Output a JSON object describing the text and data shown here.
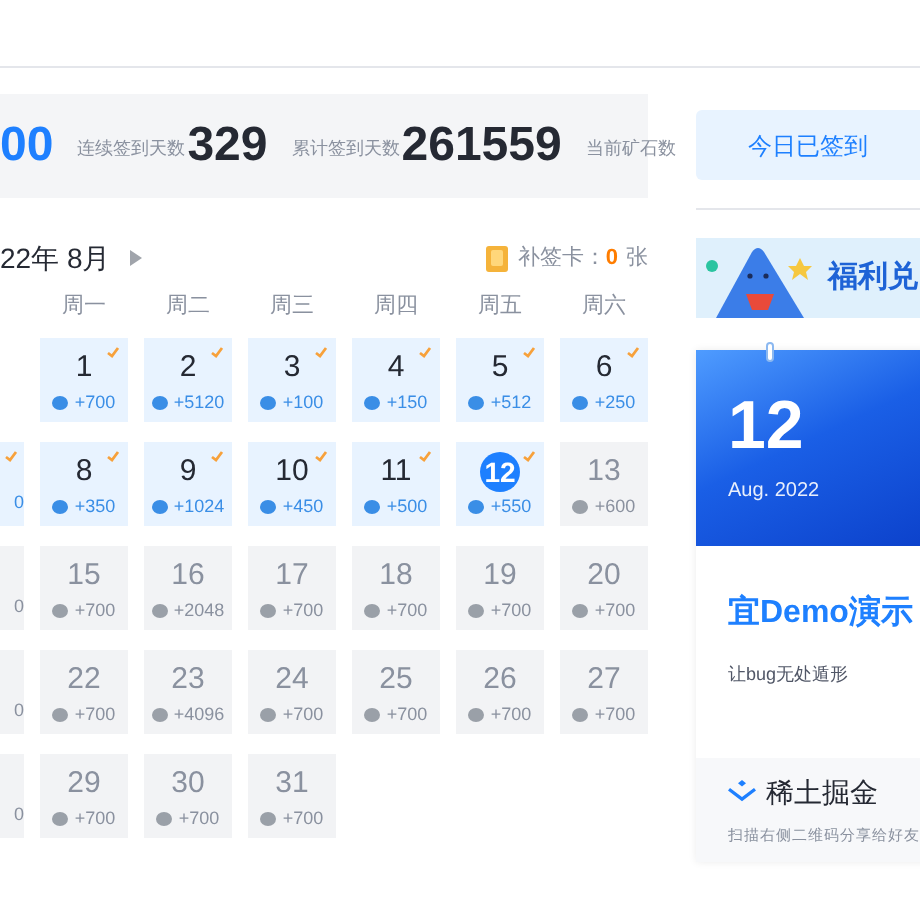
{
  "stats": [
    {
      "value": "00",
      "kind": "accent"
    },
    {
      "label": "连续签到天数",
      "value": "329",
      "kind": "plain"
    },
    {
      "label": "累计签到天数",
      "value": "261559",
      "kind": "plain"
    },
    {
      "label": "当前矿石数"
    }
  ],
  "month": {
    "label": "22年 8月"
  },
  "makeup_card": {
    "label": "补签卡：",
    "count": "0",
    "unit": "张"
  },
  "weekdays": [
    "周一",
    "周二",
    "周三",
    "周四",
    "周五",
    "周六"
  ],
  "weeks": [
    [
      {
        "kind": "blank"
      },
      {
        "kind": "day",
        "day": "1",
        "reward": "+700",
        "signed": true,
        "today": false
      },
      {
        "kind": "day",
        "day": "2",
        "reward": "+5120",
        "signed": true,
        "today": false
      },
      {
        "kind": "day",
        "day": "3",
        "reward": "+100",
        "signed": true,
        "today": false
      },
      {
        "kind": "day",
        "day": "4",
        "reward": "+150",
        "signed": true,
        "today": false
      },
      {
        "kind": "day",
        "day": "5",
        "reward": "+512",
        "signed": true,
        "today": false
      },
      {
        "kind": "day",
        "day": "6",
        "reward": "+250",
        "signed": true,
        "today": false
      }
    ],
    [
      {
        "kind": "partial",
        "reward": "0",
        "signed": true
      },
      {
        "kind": "day",
        "day": "8",
        "reward": "+350",
        "signed": true,
        "today": false
      },
      {
        "kind": "day",
        "day": "9",
        "reward": "+1024",
        "signed": true,
        "today": false
      },
      {
        "kind": "day",
        "day": "10",
        "reward": "+450",
        "signed": true,
        "today": false
      },
      {
        "kind": "day",
        "day": "11",
        "reward": "+500",
        "signed": true,
        "today": false
      },
      {
        "kind": "day",
        "day": "12",
        "reward": "+550",
        "signed": true,
        "today": true
      },
      {
        "kind": "day",
        "day": "13",
        "reward": "+600",
        "signed": false,
        "today": false
      }
    ],
    [
      {
        "kind": "partial",
        "reward": "0",
        "signed": false
      },
      {
        "kind": "day",
        "day": "15",
        "reward": "+700",
        "signed": false,
        "today": false
      },
      {
        "kind": "day",
        "day": "16",
        "reward": "+2048",
        "signed": false,
        "today": false
      },
      {
        "kind": "day",
        "day": "17",
        "reward": "+700",
        "signed": false,
        "today": false
      },
      {
        "kind": "day",
        "day": "18",
        "reward": "+700",
        "signed": false,
        "today": false
      },
      {
        "kind": "day",
        "day": "19",
        "reward": "+700",
        "signed": false,
        "today": false
      },
      {
        "kind": "day",
        "day": "20",
        "reward": "+700",
        "signed": false,
        "today": false
      }
    ],
    [
      {
        "kind": "partial",
        "reward": "0",
        "signed": false
      },
      {
        "kind": "day",
        "day": "22",
        "reward": "+700",
        "signed": false,
        "today": false
      },
      {
        "kind": "day",
        "day": "23",
        "reward": "+4096",
        "signed": false,
        "today": false
      },
      {
        "kind": "day",
        "day": "24",
        "reward": "+700",
        "signed": false,
        "today": false
      },
      {
        "kind": "day",
        "day": "25",
        "reward": "+700",
        "signed": false,
        "today": false
      },
      {
        "kind": "day",
        "day": "26",
        "reward": "+700",
        "signed": false,
        "today": false
      },
      {
        "kind": "day",
        "day": "27",
        "reward": "+700",
        "signed": false,
        "today": false
      }
    ],
    [
      {
        "kind": "partial",
        "reward": "0",
        "signed": false
      },
      {
        "kind": "day",
        "day": "29",
        "reward": "+700",
        "signed": false,
        "today": false
      },
      {
        "kind": "day",
        "day": "30",
        "reward": "+700",
        "signed": false,
        "today": false
      },
      {
        "kind": "day",
        "day": "31",
        "reward": "+700",
        "signed": false,
        "today": false
      },
      {
        "kind": "blank"
      },
      {
        "kind": "blank"
      },
      {
        "kind": "blank"
      }
    ]
  ],
  "sign_button": {
    "label": "今日已签到"
  },
  "banner": {
    "title": "福利兑"
  },
  "date_card": {
    "day": "12",
    "month": "Aug. 2022",
    "headline": "宜Demo演示",
    "subtitle": "让bug无处遁形"
  },
  "share": {
    "brand": "稀土掘金",
    "hint": "扫描右侧二维码分享给好友"
  }
}
